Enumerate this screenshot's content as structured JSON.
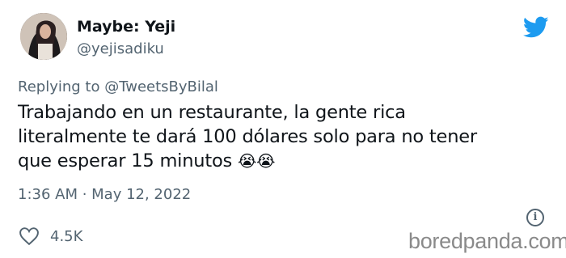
{
  "author": {
    "display_name": "Maybe: Yeji",
    "handle": "@yejisadiku"
  },
  "reply": {
    "prefix": "Replying to",
    "mention": "@TweetsByBilal"
  },
  "tweet": {
    "line1": "Trabajando en un restaurante, la gente rica",
    "line2": "literalmente te dará 100 dólares solo para no tener",
    "line3": "que esperar 15 minutos",
    "emoji": "😭😭",
    "timestamp": "1:36 AM · May 12, 2022"
  },
  "stats": {
    "likes": "4.5K"
  },
  "watermark": "boredpanda.com",
  "colors": {
    "twitter_blue": "#1d9bf0",
    "secondary_text": "#536471"
  },
  "icons": [
    "twitter-bird-icon",
    "info-icon",
    "heart-icon"
  ]
}
